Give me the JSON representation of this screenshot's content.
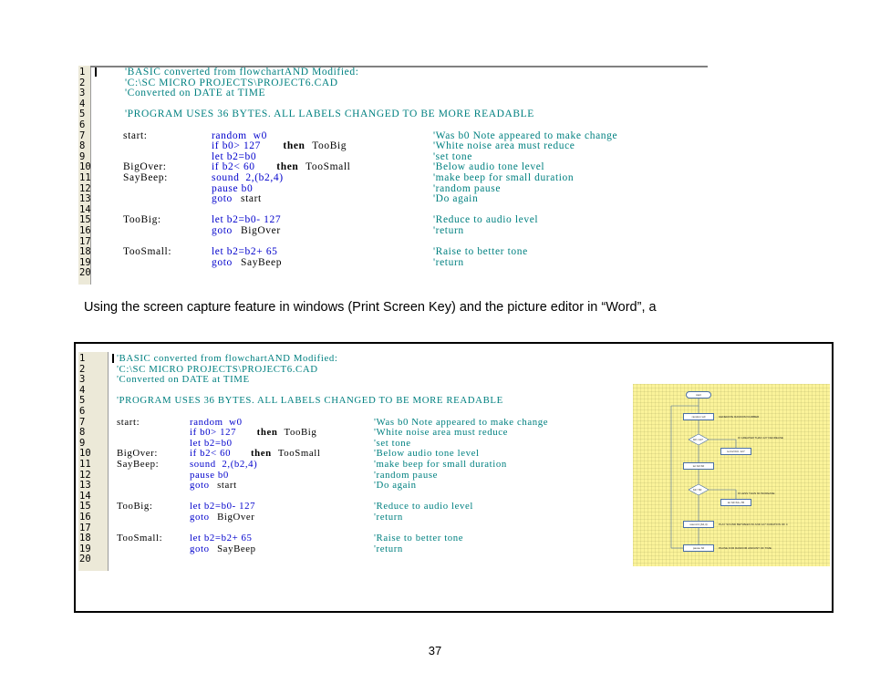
{
  "code": {
    "line_numbers": [
      "1",
      "2",
      "3",
      "4",
      "5",
      "6",
      "7",
      "8",
      "9",
      "10",
      "11",
      "12",
      "13",
      "14",
      "15",
      "16",
      "17",
      "18",
      "19",
      "20"
    ],
    "lines": [
      {
        "n": 1,
        "label": "",
        "instr": [],
        "comment": "'BASIC converted from flowchartAND Modified:"
      },
      {
        "n": 2,
        "label": "",
        "instr": [],
        "comment": "'C:\\SC MICRO PROJECTS\\PROJECT6.CAD"
      },
      {
        "n": 3,
        "label": "",
        "instr": [],
        "comment": "'Converted on DATE at TIME"
      },
      {
        "n": 5,
        "label": "",
        "instr": [],
        "comment": "'PROGRAM USES 36 BYTES. ALL LABELS CHANGED TO BE MORE READABLE"
      },
      {
        "n": 7,
        "label": "start:",
        "instr": [
          {
            "t": "random  w0",
            "c": "kw"
          }
        ],
        "comment": "'Was b0 Note appeared to make change"
      },
      {
        "n": 8,
        "label": "",
        "instr": [
          {
            "t": "if b0> 127 ",
            "c": "kw"
          },
          {
            "t": "then",
            "c": "bold"
          },
          {
            "t": " TooBig",
            "c": "plain"
          }
        ],
        "comment": "'White noise area must reduce"
      },
      {
        "n": 9,
        "label": "",
        "instr": [
          {
            "t": "let b2=b0",
            "c": "kw"
          }
        ],
        "comment": "'set tone"
      },
      {
        "n": 10,
        "label": "BigOver:",
        "instr": [
          {
            "t": "if b2< 60 ",
            "c": "kw"
          },
          {
            "t": "then",
            "c": "bold"
          },
          {
            "t": " TooSmall",
            "c": "plain"
          }
        ],
        "comment": "'Below audio tone level"
      },
      {
        "n": 11,
        "label": "SayBeep:",
        "instr": [
          {
            "t": "sound  2,(b2,4)",
            "c": "kw"
          }
        ],
        "comment": "'make beep for small duration"
      },
      {
        "n": 12,
        "label": "",
        "instr": [
          {
            "t": "pause b0",
            "c": "kw"
          }
        ],
        "comment": "'random pause"
      },
      {
        "n": 13,
        "label": "",
        "instr": [
          {
            "t": "goto",
            "c": "kw"
          },
          {
            "t": " start",
            "c": "plain"
          }
        ],
        "comment": "'Do again"
      },
      {
        "n": 15,
        "label": "TooBig:",
        "instr": [
          {
            "t": "let b2=b0- 127",
            "c": "kw"
          }
        ],
        "comment": "'Reduce to audio level"
      },
      {
        "n": 16,
        "label": "",
        "instr": [
          {
            "t": "goto",
            "c": "kw"
          },
          {
            "t": " BigOver",
            "c": "plain"
          }
        ],
        "comment": "'return"
      },
      {
        "n": 18,
        "label": "TooSmall:",
        "instr": [
          {
            "t": "let b2=b2+ 65",
            "c": "kw"
          }
        ],
        "comment": "'Raise to better tone"
      },
      {
        "n": 19,
        "label": "",
        "instr": [
          {
            "t": "goto",
            "c": "kw"
          },
          {
            "t": " SayBeep",
            "c": "plain"
          }
        ],
        "comment": "'return"
      }
    ]
  },
  "caption": "Using the screen capture feature in windows (Print Screen Key) and the picture editor in “Word”, a",
  "flowchart": {
    "boxes": [
      "start",
      "random  w0",
      "b0> 127",
      "let b2=b0- 127",
      "let b2=b0",
      "b2< 60",
      "let b2=b2+ 65",
      "sound  2,(b2,4)",
      "pause b0"
    ],
    "notes": [
      "GENERATE RANDOM NUMBER",
      "IF GREATER THAN 127 DECREASE",
      "IF LESS THAN 60 INCREASE",
      "PLAY SOUND BETWEEN 60 AND 127 DURATION OF 4",
      "PAUSE FOR RANDOM AMOUNT OF TIME"
    ]
  },
  "page_number": "37",
  "colors": {
    "comment": "#008080",
    "keyword": "#0000cc",
    "flowchart_bg": "#fbf39a",
    "gutter": "#ece9d8"
  }
}
